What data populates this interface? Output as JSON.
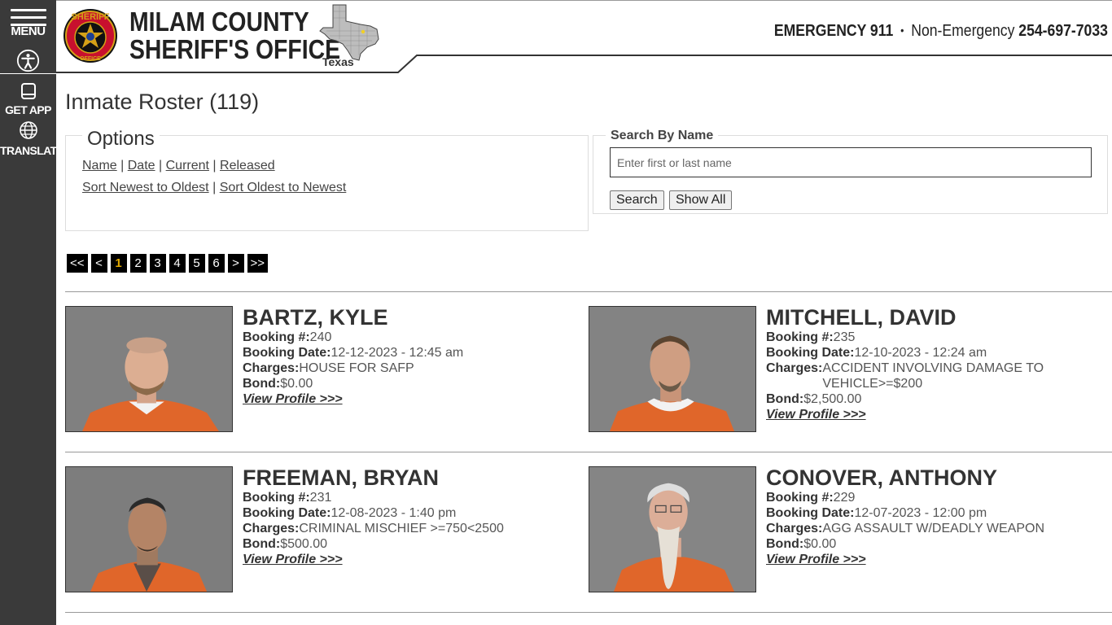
{
  "sidebar": {
    "menu_label": "MENU",
    "get_app_label": "GET APP",
    "translate_label": "TRANSLATE"
  },
  "header": {
    "badge_top": "SHERIFF",
    "badge_bottom": "OFFICE",
    "agency_line1": "MILAM COUNTY",
    "agency_line2": "SHERIFF'S OFFICE",
    "state_label": "Texas",
    "emergency_label": "EMERGENCY 911",
    "separator": "•",
    "nonemergency_label": "Non-Emergency",
    "nonemergency_phone": "254-697-7033"
  },
  "page": {
    "title": "Inmate Roster (119)"
  },
  "options": {
    "legend": "Options",
    "sort_links": [
      "Name",
      "Date",
      "Current",
      "Released"
    ],
    "order_links": [
      "Sort Newest to Oldest",
      "Sort Oldest to Newest"
    ],
    "divider": "|"
  },
  "search": {
    "legend": "Search By Name",
    "placeholder": "Enter first or last name",
    "search_button": "Search",
    "show_all_button": "Show All"
  },
  "pagination": {
    "items": [
      "<<",
      "<",
      "1",
      "2",
      "3",
      "4",
      "5",
      "6",
      ">",
      ">>"
    ],
    "active": "1"
  },
  "labels": {
    "booking_no": "Booking #:",
    "booking_date": "Booking Date:",
    "charges": "Charges:",
    "bond": "Bond:",
    "view_profile": "View Profile >>>"
  },
  "inmates": [
    {
      "name": "BARTZ, KYLE",
      "booking_no": "240",
      "booking_date": "12-12-2023 - 12:45 am",
      "charges": "HOUSE FOR SAFP",
      "bond": "$0.00"
    },
    {
      "name": "MITCHELL, DAVID",
      "booking_no": "235",
      "booking_date": "12-10-2023 - 12:24 am",
      "charges": "ACCIDENT INVOLVING DAMAGE TO VEHICLE>=$200",
      "bond": "$2,500.00"
    },
    {
      "name": "FREEMAN, BRYAN",
      "booking_no": "231",
      "booking_date": "12-08-2023 - 1:40 pm",
      "charges": "CRIMINAL MISCHIEF >=750<2500",
      "bond": "$500.00"
    },
    {
      "name": "CONOVER, ANTHONY",
      "booking_no": "229",
      "booking_date": "12-07-2023 - 12:00 pm",
      "charges": "AGG ASSAULT W/DEADLY WEAPON",
      "bond": "$0.00"
    }
  ],
  "colors": {
    "sidebar_bg": "#3a3a3a",
    "badge_red": "#c8102e",
    "badge_gold": "#d4a017",
    "active_page": "#e0a800",
    "uniform_orange": "#e0662a"
  }
}
